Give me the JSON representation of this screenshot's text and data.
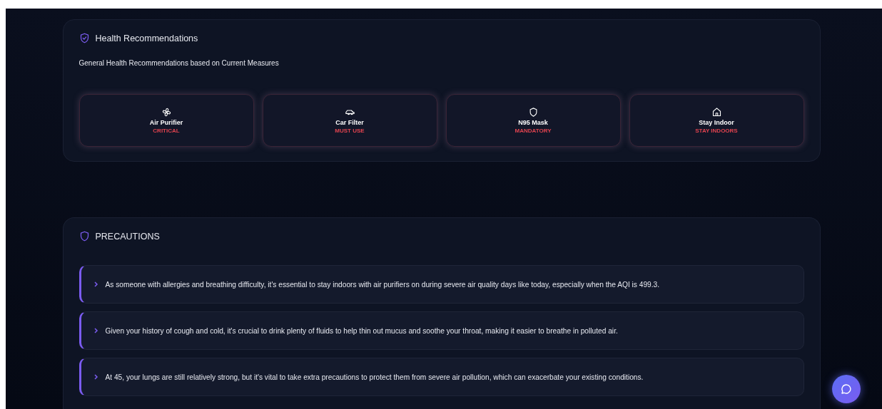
{
  "health": {
    "title": "Health Recommendations",
    "subtitle": "General Health Recommendations based on Current Measures",
    "items": [
      {
        "kind": "fan",
        "label": "Air Purifier",
        "status": "CRITICAL"
      },
      {
        "kind": "car",
        "label": "Car Filter",
        "status": "MUST USE"
      },
      {
        "kind": "shield",
        "label": "N95 Mask",
        "status": "MANDATORY"
      },
      {
        "kind": "home",
        "label": "Stay Indoor",
        "status": "STAY INDOORS"
      }
    ]
  },
  "precautions": {
    "title": "PRECAUTIONS",
    "items": [
      {
        "text": "As someone with allergies and breathing difficulty, it's essential to stay indoors with air purifiers on during severe air quality days like today, especially when the AQI is 499.3."
      },
      {
        "text": "Given your history of cough and cold, it's crucial to drink plenty of fluids to help thin out mucus and soothe your throat, making it easier to breathe in polluted air."
      },
      {
        "text": "At 45, your lungs are still relatively strong, but it's vital to take extra precautions to protect them from severe air pollution, which can exacerbate your existing conditions."
      }
    ]
  }
}
